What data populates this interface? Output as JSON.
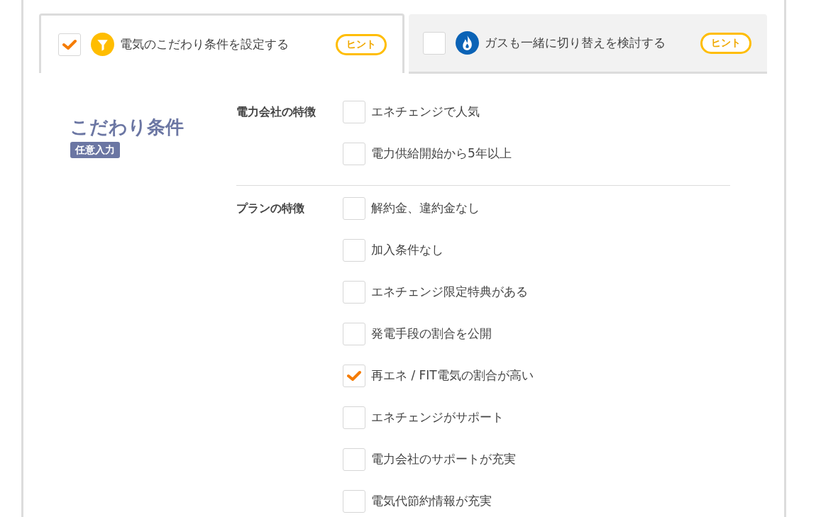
{
  "tabs": [
    {
      "label": "電気のこだわり条件を設定する",
      "kind": "filter",
      "checked": true,
      "selected": true,
      "hint": "ヒント"
    },
    {
      "label": "ガスも一緒に切り替えを検討する",
      "kind": "gas",
      "checked": false,
      "selected": false,
      "hint": "ヒント"
    }
  ],
  "section": {
    "title": "こだわり条件",
    "badge": "任意入力"
  },
  "groups": [
    {
      "label": "電力会社の特徴",
      "options": [
        {
          "label": "エネチェンジで人気",
          "checked": false
        },
        {
          "label": "電力供給開始から5年以上",
          "checked": false
        }
      ]
    },
    {
      "label": "プランの特徴",
      "options": [
        {
          "label": "解約金、違約金なし",
          "checked": false
        },
        {
          "label": "加入条件なし",
          "checked": false
        },
        {
          "label": "エネチェンジ限定特典がある",
          "checked": false
        },
        {
          "label": "発電手段の割合を公開",
          "checked": false
        },
        {
          "label": "再エネ / FIT電気の割合が高い",
          "checked": true
        },
        {
          "label": "エネチェンジがサポート",
          "checked": false
        },
        {
          "label": "電力会社のサポートが充実",
          "checked": false
        },
        {
          "label": "電気代節約情報が充実",
          "checked": false
        }
      ]
    }
  ]
}
